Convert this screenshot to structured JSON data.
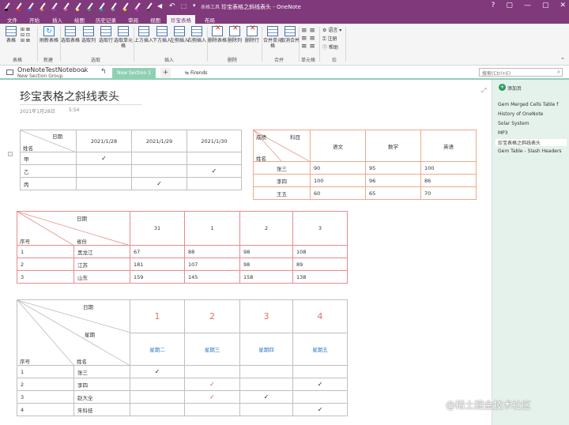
{
  "window": {
    "title": "珍宝表格之斜线表头 - OneNote",
    "tool_context": "表格工具",
    "controls": [
      "?",
      "▢",
      "—",
      "▢",
      "✕"
    ]
  },
  "tabs": [
    "文件",
    "开始",
    "插入",
    "绘图",
    "历史记录",
    "审阅",
    "视图",
    "珍宝表格",
    "布局"
  ],
  "ribbon": {
    "groups": {
      "table": "表格",
      "new": "新建",
      "select": "选取",
      "insert": "插入",
      "delete": "删除",
      "merge": "合并",
      "cell": "单元格",
      "jewel": "珍"
    },
    "buttons": {
      "table": "表格",
      "refresh": "刷新表格",
      "select_table": "选取表格",
      "select_col": "选取列",
      "select_row": "选取行",
      "select_cell": "选取单元格",
      "insert_above": "上方插入",
      "insert_below": "下方插入",
      "insert_left": "左侧插入",
      "insert_right": "右侧插入",
      "delete_table": "删除表格",
      "delete_col": "删除列",
      "delete_row": "删除行",
      "merge_cells": "合并单元格",
      "unmerge": "取消合并",
      "lang": "语言",
      "register": "注册",
      "help": "帮助"
    }
  },
  "notebook": {
    "name": "OneNoteTestNotebook",
    "section_group": "New Section Group",
    "active_section": "New Section 1",
    "add_tab": "+",
    "group_tab": "Firends",
    "search_placeholder": "搜索(Ctrl+E)"
  },
  "pages": {
    "add_label": "添加页",
    "items": [
      "Gem Merged Cells Table f",
      "History of OneNote",
      "Solar System",
      "MP3",
      "珍宝表格之斜线表头",
      "Gem Table - Slash Headers"
    ],
    "selected_index": 4
  },
  "page": {
    "title": "珍宝表格之斜线表头",
    "date": "2021年1月28日",
    "time": "5:54"
  },
  "table1": {
    "diag_top": "日期",
    "diag_bottom": "姓名",
    "dates": [
      "2021/1/28",
      "2021/1/29",
      "2021/1/30"
    ],
    "rows": [
      {
        "name": "甲",
        "marks": [
          "✓",
          "",
          ""
        ]
      },
      {
        "name": "乙",
        "marks": [
          "",
          "",
          "✓"
        ]
      },
      {
        "name": "丙",
        "marks": [
          "",
          "✓",
          ""
        ]
      }
    ]
  },
  "table2": {
    "diag_top": "科目",
    "diag_left": "成绩",
    "diag_bottom": "姓名",
    "subjects": [
      "语文",
      "数学",
      "英语"
    ],
    "rows": [
      {
        "name": "张三",
        "scores": [
          "90",
          "95",
          "100"
        ]
      },
      {
        "name": "李四",
        "scores": [
          "100",
          "96",
          "86"
        ]
      },
      {
        "name": "王五",
        "scores": [
          "60",
          "65",
          "70"
        ]
      }
    ]
  },
  "table3": {
    "diag_top": "日期",
    "diag_left": "序号",
    "diag_mid": "省份",
    "days": [
      "31",
      "1",
      "2",
      "3"
    ],
    "rows": [
      {
        "no": "1",
        "province": "黑龙江",
        "values": [
          "67",
          "88",
          "98",
          "108"
        ]
      },
      {
        "no": "2",
        "province": "江苏",
        "values": [
          "181",
          "107",
          "98",
          "89"
        ]
      },
      {
        "no": "3",
        "province": "山东",
        "values": [
          "159",
          "145",
          "158",
          "138"
        ]
      }
    ]
  },
  "table4": {
    "diag_top": "日期",
    "diag_mid": "星期",
    "diag_left": "序号",
    "diag_bottom": "姓名",
    "nums": [
      "1",
      "2",
      "3",
      "4"
    ],
    "weekdays": [
      "星期二",
      "星期三",
      "星期四",
      "星期五"
    ],
    "rows": [
      {
        "no": "1",
        "name": "张三",
        "marks": [
          "✓",
          "",
          "",
          ""
        ]
      },
      {
        "no": "2",
        "name": "李四",
        "marks": [
          "",
          "✓",
          "",
          "✓"
        ]
      },
      {
        "no": "3",
        "name": "赵大全",
        "marks": [
          "",
          "✓",
          "✓",
          ""
        ]
      },
      {
        "no": "4",
        "name": "朱科技",
        "marks": [
          "",
          "",
          "",
          "✓"
        ]
      }
    ]
  },
  "watermark": "@稀土掘金技术社区",
  "colors": {
    "brand": "#80397b",
    "section": "#8fd0b5",
    "pane": "#e5f2ec"
  }
}
